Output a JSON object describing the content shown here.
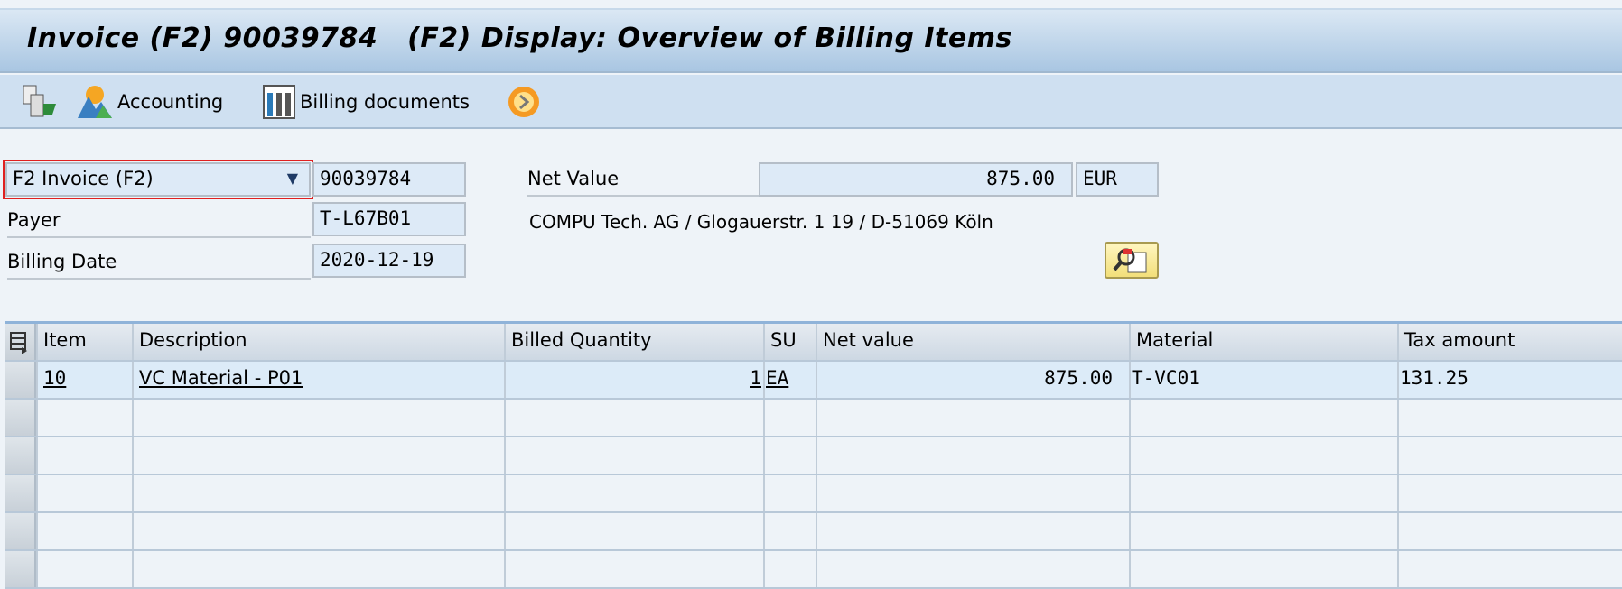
{
  "window": {
    "title": "Invoice (F2) 90039784   (F2) Display: Overview of Billing Items"
  },
  "toolbar": {
    "items": [
      {
        "label": "",
        "icon": "document-flow-icon"
      },
      {
        "label": "Accounting",
        "icon": "accounting-icon"
      },
      {
        "label": "Billing documents",
        "icon": "billing-documents-icon"
      },
      {
        "label": "",
        "icon": "services-icon"
      }
    ]
  },
  "header": {
    "doc_type": "F2 Invoice (F2)",
    "doc_number": "90039784",
    "net_value_label": "Net Value",
    "net_value": "875.00",
    "currency": "EUR",
    "payer_label": "Payer",
    "payer": "T-L67B01",
    "payer_address": "COMPU Tech. AG / Glogauerstr. 1 19 / D-51069 Köln",
    "billing_date_label": "Billing Date",
    "billing_date": "2020-12-19"
  },
  "table": {
    "columns": [
      "Item",
      "Description",
      "Billed Quantity",
      "SU",
      "Net value",
      "Material",
      "Tax amount"
    ],
    "rows": [
      [
        "10",
        "VC Material  - P01",
        "1",
        "EA",
        "875.00",
        "T-VC01",
        "131.25"
      ]
    ],
    "empty_rows": 5
  },
  "colors": {
    "title_bar": "#a9c6e2",
    "toolbar": "#cfe0f1",
    "field": "#ddeaf7",
    "selected_row": "#dcebf8",
    "focus": "#e02020"
  }
}
